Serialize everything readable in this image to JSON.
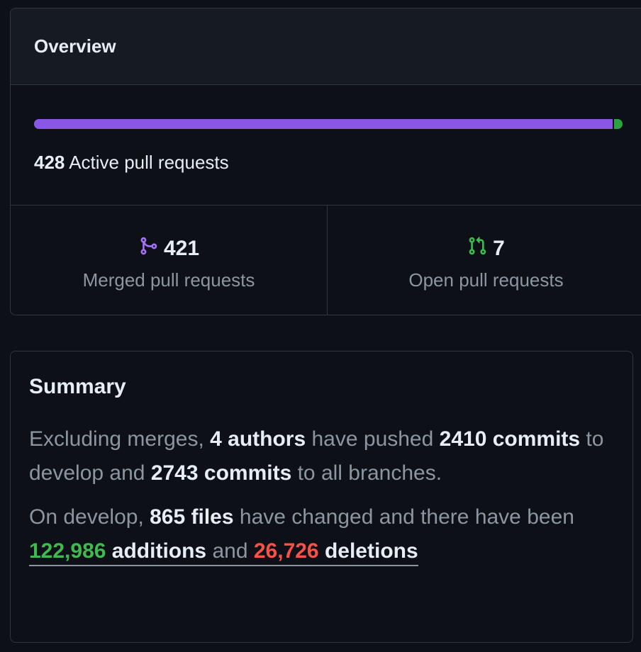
{
  "overview": {
    "title": "Overview",
    "active_count": "428",
    "active_label": "Active pull requests",
    "merged_fraction": 0.9836,
    "colors": {
      "merged": "#8957e5",
      "open": "#2ea043",
      "additions": "#3fb950",
      "deletions": "#f85149"
    },
    "merged": {
      "icon": "git-merge-icon",
      "count": "421",
      "label": "Merged pull requests"
    },
    "open": {
      "icon": "git-pull-request-icon",
      "count": "7",
      "label": "Open pull requests"
    }
  },
  "summary": {
    "title": "Summary",
    "p1": {
      "prefix": "Excluding merges, ",
      "authors": "4 authors",
      "mid1": " have pushed ",
      "commits_develop": "2410 commits",
      "mid2": " to develop and ",
      "commits_all": "2743 commits",
      "suffix": " to all branches."
    },
    "p2": {
      "prefix": "On develop, ",
      "files": "865 files",
      "mid1": " have changed and there have been ",
      "additions_num": "122,986",
      "additions_word": " additions",
      "mid2": " and ",
      "deletions_num": "26,726",
      "deletions_word": " deletions"
    }
  }
}
